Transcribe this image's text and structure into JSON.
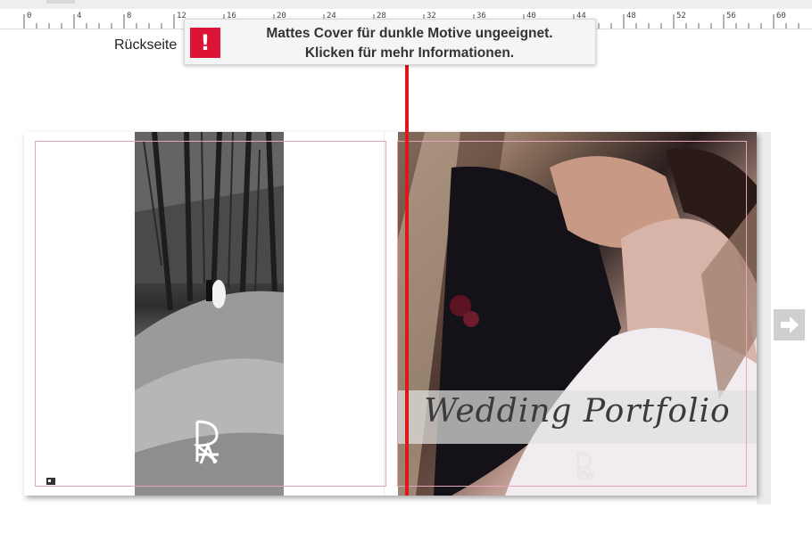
{
  "ruler": {
    "labels": [
      "0",
      "4",
      "8",
      "12",
      "16",
      "20",
      "24",
      "28",
      "32",
      "36",
      "40",
      "44",
      "48",
      "52",
      "56",
      "60"
    ]
  },
  "page_label": "Rückseite",
  "alert": {
    "icon": "exclamation-icon",
    "glyph": "!",
    "line1": "Mattes Cover für dunkle Motive ungeeignet.",
    "line2": "Klicken für mehr Informationen."
  },
  "cover": {
    "title": "Wedding Portfolio"
  },
  "colors": {
    "alert_red": "#dd1436",
    "fold_line": "#e0161d",
    "bleed_margin": "#e7a3b7"
  },
  "nav": {
    "next_icon": "arrow-right-icon"
  }
}
